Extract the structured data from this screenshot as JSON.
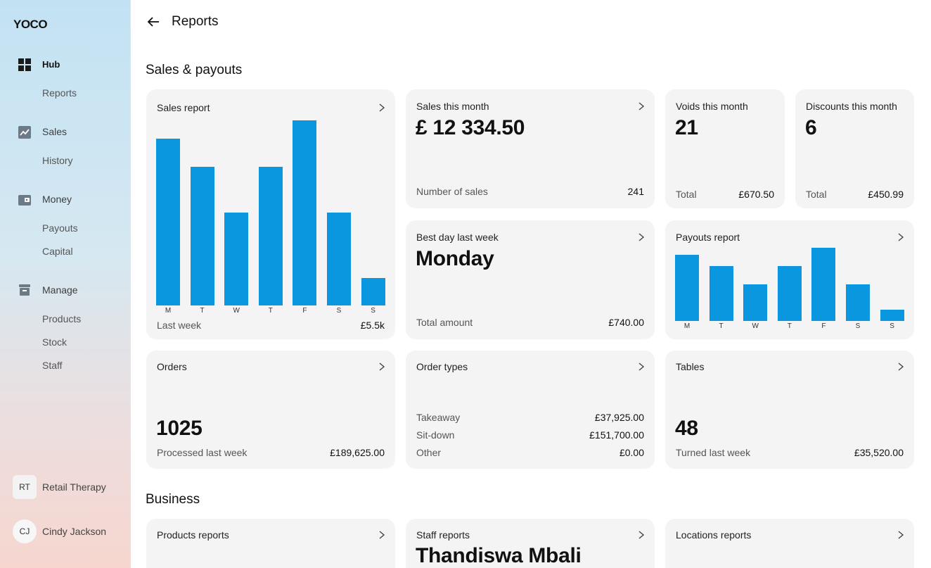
{
  "brand": {
    "logo": "YOCO",
    "accent": "#0b97e0"
  },
  "sidebar": {
    "items": [
      {
        "label": "Hub",
        "icon": "grid-icon",
        "active": true
      },
      {
        "label": "Reports",
        "sub": true
      },
      {
        "label": "Sales",
        "icon": "chart-icon"
      },
      {
        "label": "History",
        "sub": true
      },
      {
        "label": "Money",
        "icon": "wallet-icon"
      },
      {
        "label": "Payouts",
        "sub": true
      },
      {
        "label": "Capital",
        "sub": true
      },
      {
        "label": "Manage",
        "icon": "box-icon"
      },
      {
        "label": "Products",
        "sub": true
      },
      {
        "label": "Stock",
        "sub": true
      },
      {
        "label": "Staff",
        "sub": true
      }
    ],
    "business": {
      "initials": "RT",
      "name": "Retail Therapy"
    },
    "user": {
      "initials": "CJ",
      "name": "Cindy Jackson"
    }
  },
  "header": {
    "title": "Reports"
  },
  "sections": {
    "sales": "Sales & payouts",
    "business": "Business"
  },
  "cards": {
    "sales_report": {
      "title": "Sales report",
      "footer_label": "Last week",
      "footer_value": "£5.5k",
      "days": [
        "M",
        "T",
        "W",
        "T",
        "F",
        "S",
        "S"
      ],
      "values": [
        90,
        75,
        50,
        75,
        100,
        50,
        15
      ]
    },
    "sales_month": {
      "title": "Sales this month",
      "value": "£ 12 334.50",
      "label": "Number of sales",
      "count": "241"
    },
    "voids": {
      "title": "Voids this month",
      "value": "21",
      "label": "Total",
      "amount": "£670.50"
    },
    "discounts": {
      "title": "Discounts this month",
      "value": "6",
      "label": "Total",
      "amount": "£450.99"
    },
    "best_day": {
      "title": "Best day last week",
      "value": "Monday",
      "label": "Total amount",
      "amount": "£740.00"
    },
    "payouts": {
      "title": "Payouts report",
      "days": [
        "M",
        "T",
        "W",
        "T",
        "F",
        "S",
        "S"
      ],
      "values": [
        90,
        75,
        50,
        75,
        100,
        50,
        15
      ]
    },
    "orders": {
      "title": "Orders",
      "value": "1025",
      "label": "Processed last week",
      "amount": "£189,625.00"
    },
    "order_types": {
      "title": "Order types",
      "rows": [
        {
          "label": "Takeaway",
          "value": "£37,925.00"
        },
        {
          "label": "Sit-down",
          "value": "£151,700.00"
        },
        {
          "label": "Other",
          "value": "£0.00"
        }
      ]
    },
    "tables": {
      "title": "Tables",
      "value": "48",
      "label": "Turned last week",
      "amount": "£35,520.00"
    },
    "products_reports": {
      "title": "Products reports"
    },
    "staff_reports": {
      "title": "Staff reports",
      "value": "Thandiswa Mbali"
    },
    "locations_reports": {
      "title": "Locations reports"
    }
  }
}
